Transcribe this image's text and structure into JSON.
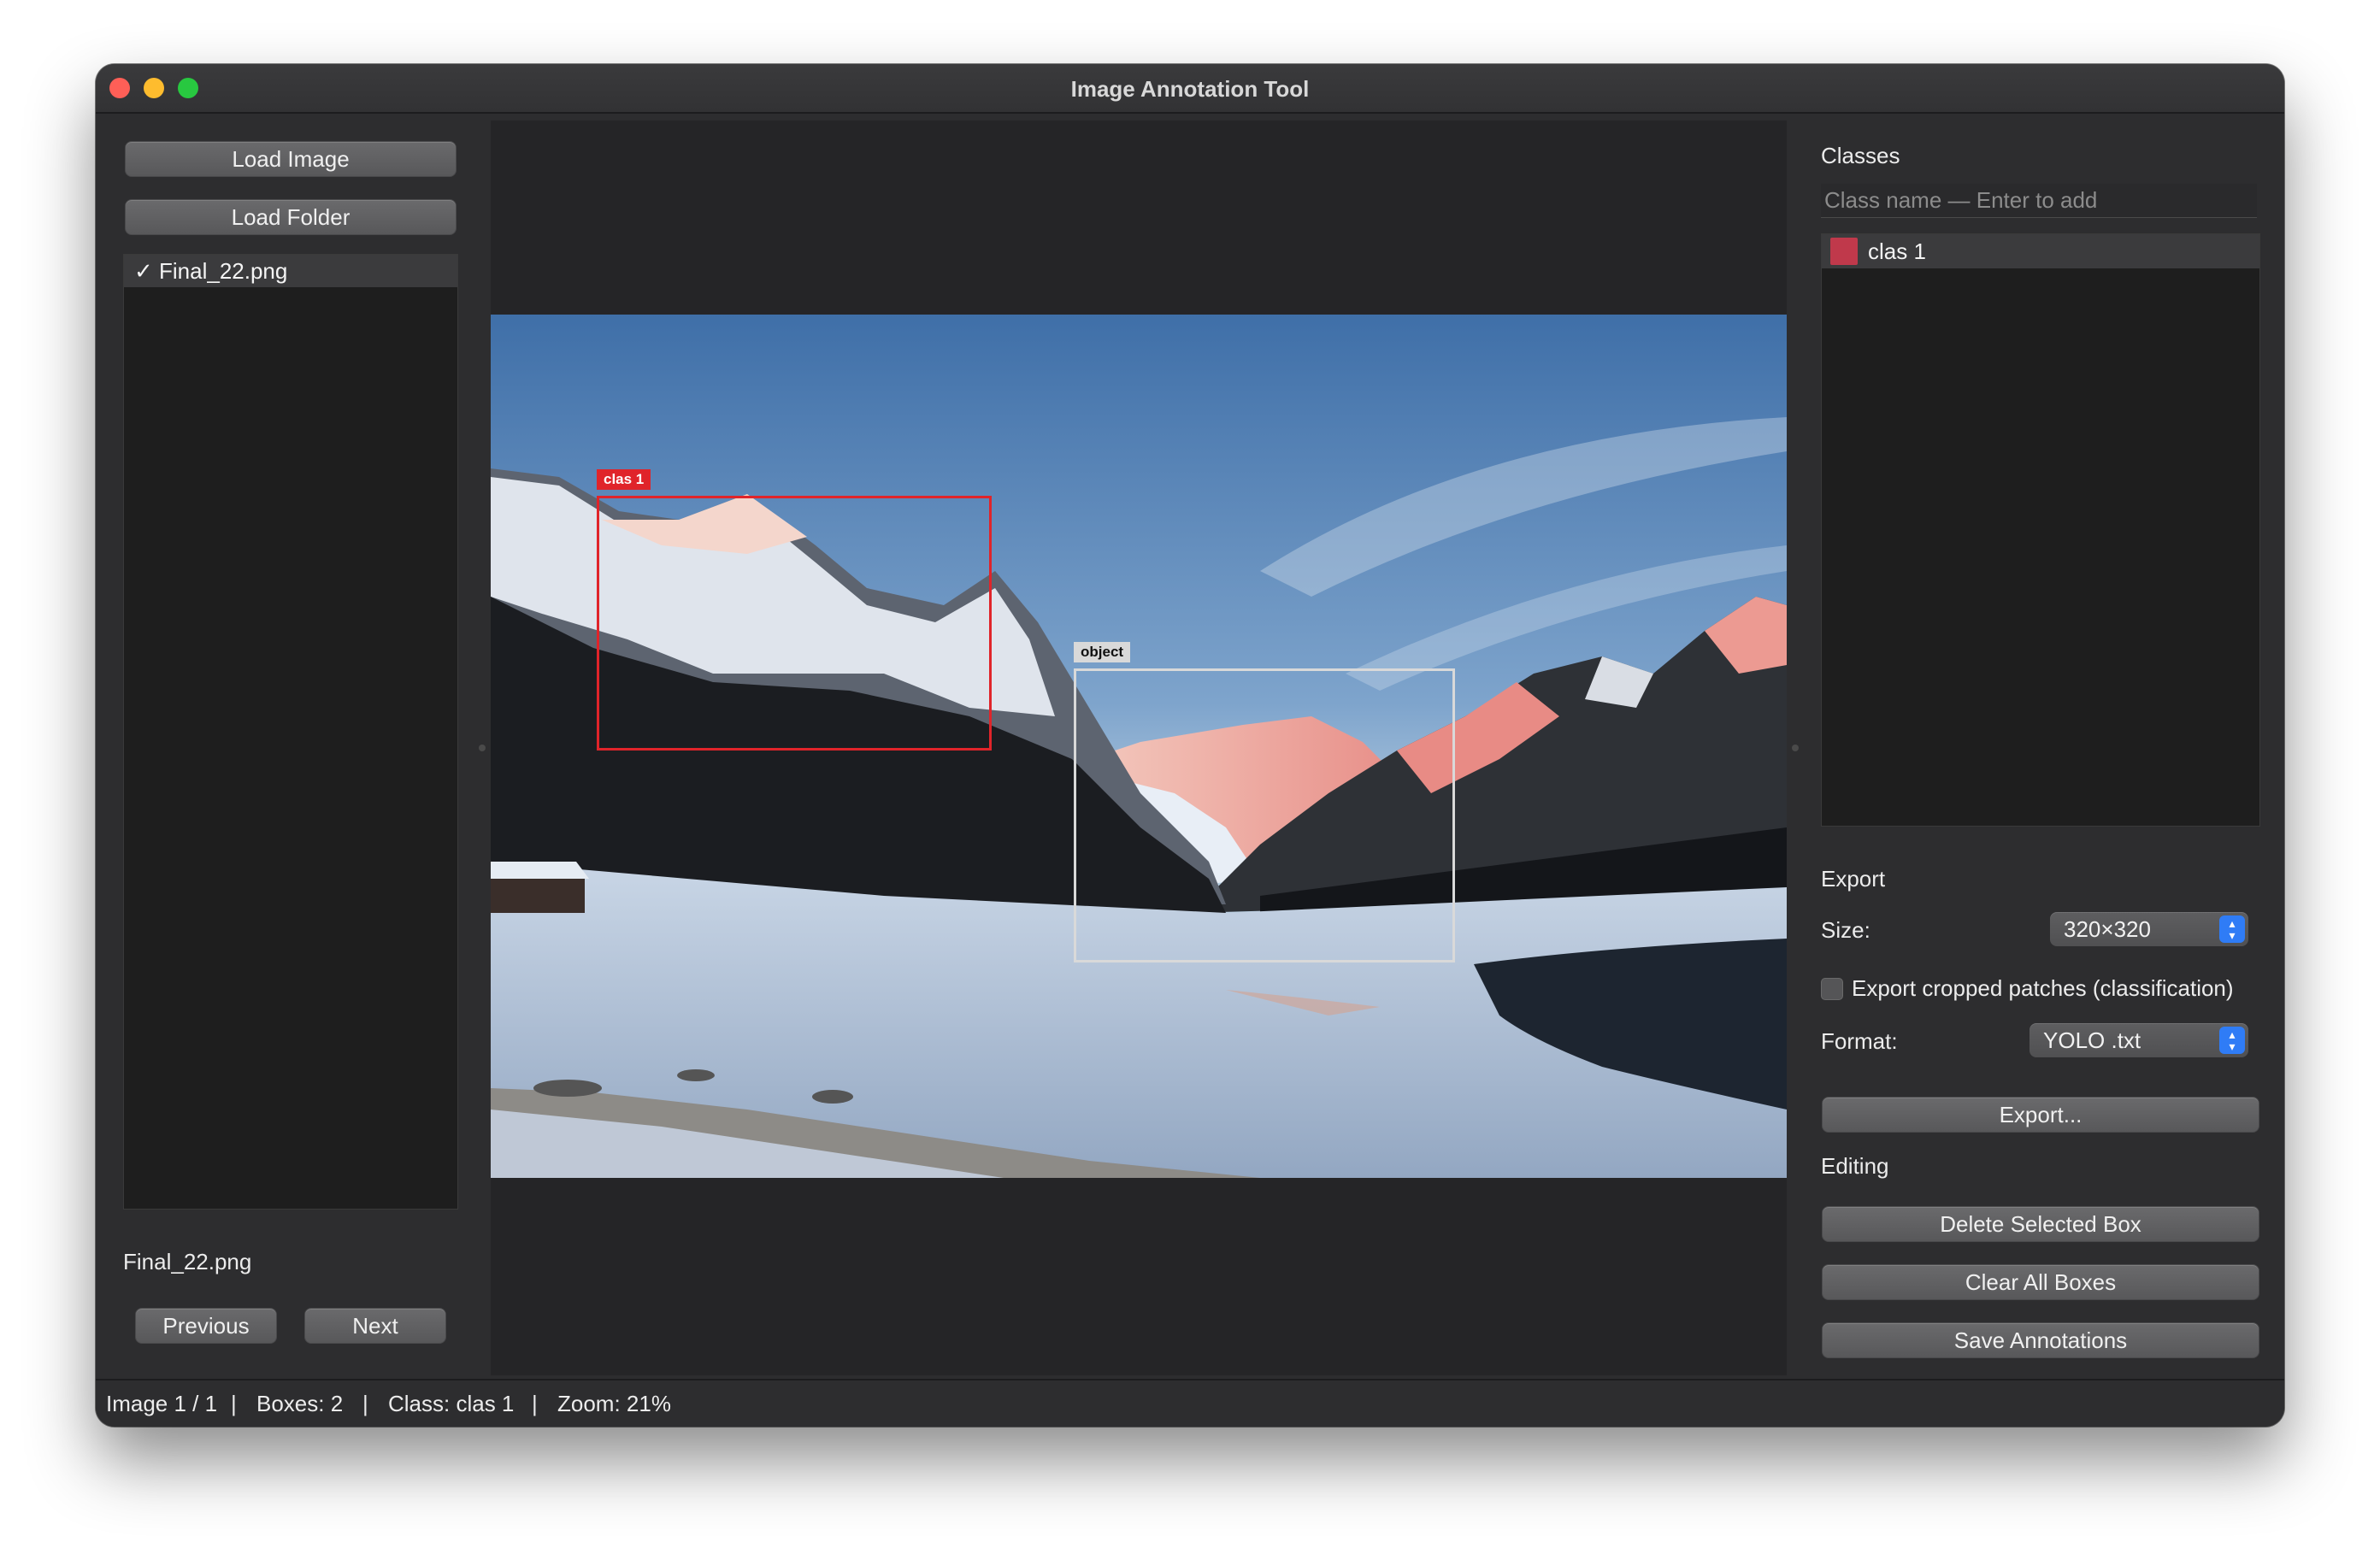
{
  "window": {
    "title": "Image Annotation Tool"
  },
  "sidebar": {
    "load_image": "Load Image",
    "load_folder": "Load Folder",
    "files": [
      {
        "label": "✓ Final_22.png"
      }
    ],
    "current_file": "Final_22.png",
    "previous": "Previous",
    "next": "Next"
  },
  "canvas": {
    "boxes": [
      {
        "label": "clas 1",
        "color": "#e0242a"
      },
      {
        "label": "object",
        "color": "#d9d9d9"
      }
    ]
  },
  "classes": {
    "heading": "Classes",
    "input_placeholder": "Class name — Enter to add",
    "items": [
      {
        "label": "clas 1",
        "color": "#c0394b"
      }
    ]
  },
  "export": {
    "heading": "Export",
    "size_label": "Size:",
    "size_value": "320×320",
    "cropped_label": "Export cropped patches (classification)",
    "cropped_checked": false,
    "format_label": "Format:",
    "format_value": "YOLO .txt",
    "export_button": "Export..."
  },
  "editing": {
    "heading": "Editing",
    "delete_selected": "Delete Selected Box",
    "clear_all": "Clear All Boxes",
    "save": "Save Annotations"
  },
  "status": {
    "image": "Image 1 / 1",
    "boxes": "Boxes: 2",
    "class": "Class: clas 1",
    "zoom": "Zoom: 21%",
    "separator": "|"
  }
}
